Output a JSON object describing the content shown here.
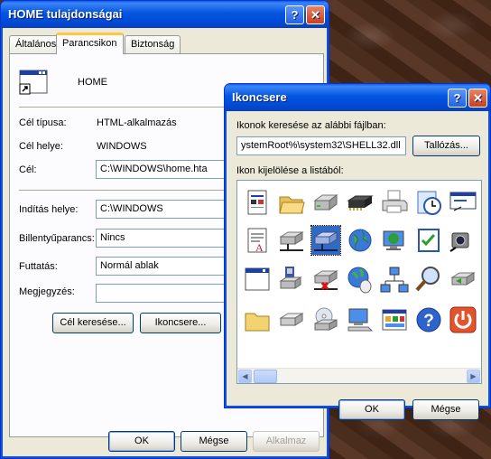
{
  "props_window": {
    "title": "HOME tulajdonságai",
    "tabs": [
      "Általános",
      "Parancsikon",
      "Biztonság"
    ],
    "name": "HOME",
    "fields": {
      "target_type_label": "Cél típusa:",
      "target_type_value": "HTML-alkalmazás",
      "target_location_label": "Cél helye:",
      "target_location_value": "WINDOWS",
      "target_label": "Cél:",
      "target_value": "C:\\WINDOWS\\home.hta",
      "start_in_label": "Indítás helye:",
      "start_in_value": "C:\\WINDOWS",
      "shortcut_key_label": "Billentyűparancs:",
      "shortcut_key_value": "Nincs",
      "run_label": "Futtatás:",
      "run_value": "Normál ablak",
      "comment_label": "Megjegyzés:",
      "comment_value": ""
    },
    "find_target_button": "Cél keresése...",
    "change_icon_button": "Ikoncsere...",
    "ok_button": "OK",
    "cancel_button": "Mégse",
    "apply_button": "Alkalmaz"
  },
  "icon_dialog": {
    "title": "Ikoncsere",
    "search_label": "Ikonok keresése az alábbi fájlban:",
    "file_path": "ystemRoot%\\system32\\SHELL32.dll",
    "browse_button": "Tallózás...",
    "select_label": "Ikon kijelölése a listából:",
    "ok_button": "OK",
    "cancel_button": "Mégse",
    "icons": [
      [
        "document-icon",
        "folder-open-icon",
        "drive-icon",
        "memory-chip-icon",
        "printer-icon",
        "scheduled-tasks-icon",
        "window-arrow-icon"
      ],
      [
        "document-letter-icon",
        "network-drive-icon",
        "network-drive-selected-icon",
        "globe-icon",
        "monitor-globe-icon",
        "checklist-icon",
        "webcam-icon"
      ],
      [
        "window-icon",
        "floppy-icon",
        "drive-disconnected-icon",
        "globe-mouse-icon",
        "network-icon",
        "search-magnifier-icon",
        "drive-arrow-icon"
      ],
      [
        "folder-icon",
        "hard-drive-icon",
        "cd-drive-icon",
        "computer-icon",
        "control-panel-icon",
        "help-icon",
        "shutdown-icon"
      ]
    ]
  },
  "titlebar_buttons": {
    "help": "?",
    "close": "✕"
  }
}
